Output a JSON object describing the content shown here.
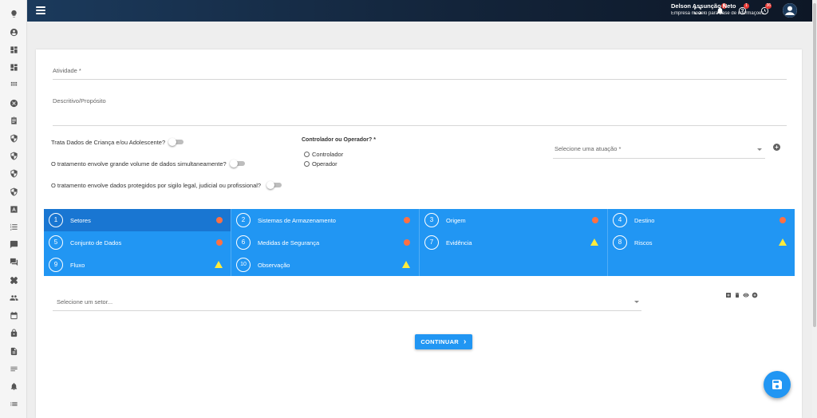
{
  "header": {
    "notifications_badge": "2",
    "help_badge": "1",
    "updates_badge": "36",
    "user_name": "Delson Assunção Neto",
    "company": "Empresa modelo para base de informações",
    "bg_color": "#13243a"
  },
  "sidebar": {
    "icons": [
      "lightbulb-icon",
      "account-circle-icon",
      "dashboard-icon",
      "dashboard-alt-icon",
      "apps-grid-icon",
      "cancel-circle-icon",
      "clipboard-icon",
      "shield-icon",
      "shield-icon",
      "shield-icon",
      "shield-icon",
      "font-box-icon",
      "list-numbered-icon",
      "chat-icon",
      "forum-icon",
      "bandage-icon",
      "people-icon",
      "calendar-icon",
      "lock-icon",
      "document-icon",
      "notes-icon",
      "alarm-icon",
      "list-icon"
    ]
  },
  "form": {
    "atividade_label": "Atividade *",
    "descritivo_label": "Descritivo/Propósito",
    "q_crianca": "Trata Dados de Criança e/ou Adolescente?",
    "q_volume": "O tratamento envolve grande volume de dados simultaneamente?",
    "q_sigilo": "O tratamento envolve dados protegidos por sigilo legal, judicial ou profissional?",
    "controlador_heading": "Controlador ou Operador? *",
    "opt_controlador": "Controlador",
    "opt_operador": "Operador",
    "atuacao_placeholder": "Selecione uma atuação *"
  },
  "steps": [
    {
      "n": "1",
      "label": "Setores",
      "status": "error"
    },
    {
      "n": "2",
      "label": "Sistemas de Armazenamento",
      "status": "error"
    },
    {
      "n": "3",
      "label": "Origem",
      "status": "error"
    },
    {
      "n": "4",
      "label": "Destino",
      "status": "error"
    },
    {
      "n": "5",
      "label": "Conjunto de Dados",
      "status": "error"
    },
    {
      "n": "6",
      "label": "Medidas de Segurança",
      "status": "error"
    },
    {
      "n": "7",
      "label": "Evidência",
      "status": "warning"
    },
    {
      "n": "8",
      "label": "Riscos",
      "status": "warning"
    },
    {
      "n": "9",
      "label": "Fluxo",
      "status": "warning"
    },
    {
      "n": "10",
      "label": "Observação",
      "status": "warning"
    }
  ],
  "setor": {
    "placeholder": "Selecione um setor..."
  },
  "actions": {
    "continue_label": "CONTINUAR",
    "continue_chevron": "›"
  },
  "colors": {
    "primary": "#2196f3",
    "active_step": "#1976d2",
    "error_dot": "#ff7043",
    "warning": "#ffeb3b"
  }
}
